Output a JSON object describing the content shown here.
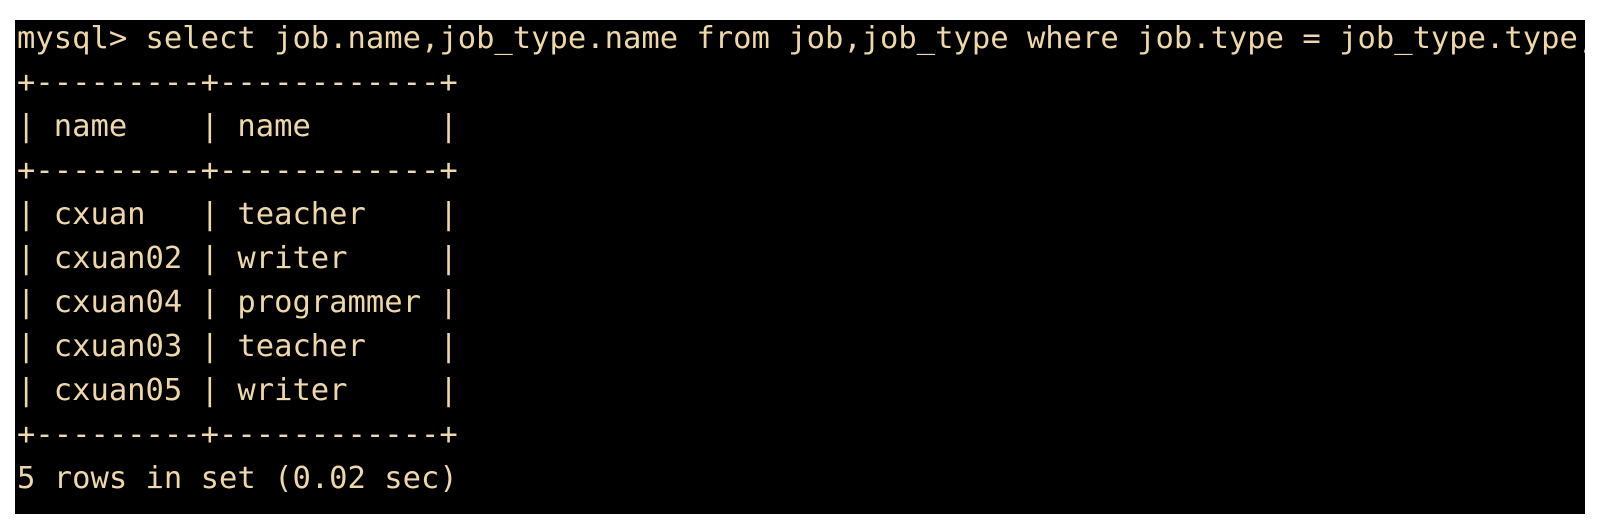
{
  "terminal": {
    "prompt": "mysql> ",
    "command": "select job.name,job_type.name from job,job_type where job.type = job_type.type;",
    "table": {
      "separator": "+---------+------------+",
      "header_row": "| name    | name       |",
      "rows": [
        "| cxuan   | teacher    |",
        "| cxuan02 | writer     |",
        "| cxuan04 | programmer |",
        "| cxuan03 | teacher    |",
        "| cxuan05 | writer     |"
      ]
    },
    "result_summary": "5 rows in set (0.02 sec)"
  },
  "colors": {
    "background": "#000000",
    "text": "#eed7a9"
  }
}
